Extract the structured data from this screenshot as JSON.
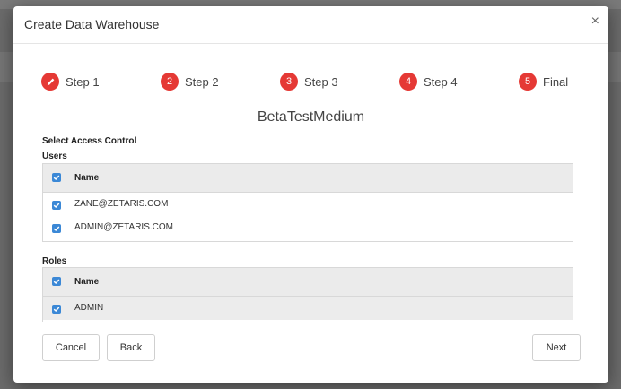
{
  "dialog": {
    "title": "Create Data Warehouse",
    "close_symbol": "×"
  },
  "stepper": {
    "steps": [
      {
        "badge": "",
        "label": "Step 1",
        "icon": "pencil-icon",
        "state": "current"
      },
      {
        "badge": "2",
        "label": "Step 2"
      },
      {
        "badge": "3",
        "label": "Step 3"
      },
      {
        "badge": "4",
        "label": "Step 4"
      },
      {
        "badge": "5",
        "label": "Final"
      }
    ],
    "color": "#e53935"
  },
  "warehouse_name": "BetaTestMedium",
  "access_control": {
    "heading": "Select Access Control",
    "users": {
      "label": "Users",
      "column_header": "Name",
      "header_checked": true,
      "rows": [
        {
          "name": "ZANE@ZETARIS.COM",
          "checked": true
        },
        {
          "name": "ADMIN@ZETARIS.COM",
          "checked": true
        }
      ]
    },
    "roles": {
      "label": "Roles",
      "column_header": "Name",
      "header_checked": true,
      "rows": [
        {
          "name": "ADMIN",
          "checked": true
        }
      ]
    }
  },
  "footer": {
    "cancel_label": "Cancel",
    "back_label": "Back",
    "next_label": "Next"
  },
  "colors": {
    "checkbox": "#3b88d6",
    "overlay": "#6b6b6b"
  }
}
